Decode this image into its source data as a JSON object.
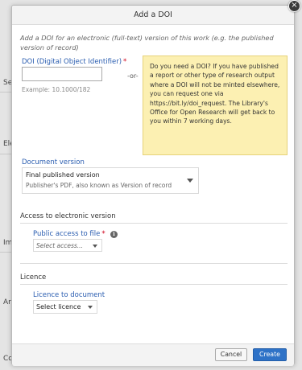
{
  "background": {
    "labels": [
      "Set",
      "Ele",
      "Im",
      "Art",
      "Co"
    ]
  },
  "modal": {
    "title": "Add a DOI",
    "intro": "Add a DOI for an electronic (full-text) version of this work (e.g. the published version of record)",
    "doi": {
      "label": "DOI (Digital Object Identifier)",
      "required_mark": "*",
      "value": "",
      "example": "Example: 10.1000/182",
      "separator": "-or-",
      "note": "Do you need a DOI? If you have published a report or other type of research output where a DOI will not be minted elsewhere, you can request one via https://bit.ly/doi_request. The Library's Office for Open Research will get back to you within 7 working days."
    },
    "document_version": {
      "label": "Document version",
      "selected": "Final published version",
      "selected_description": "Publisher's PDF, also known as Version of record"
    },
    "access_section": {
      "heading": "Access to electronic version",
      "public_access_label": "Public access to file",
      "required_mark": "*",
      "placeholder": "Select access..."
    },
    "licence_section": {
      "heading": "Licence",
      "licence_label": "Licence to document",
      "selected": "Select licence"
    },
    "buttons": {
      "cancel": "Cancel",
      "create": "Create"
    }
  },
  "colors": {
    "link_label": "#2a5db0",
    "required": "#d0021b",
    "note_background": "#fcf0b2",
    "primary_button": "#2e72c7"
  }
}
